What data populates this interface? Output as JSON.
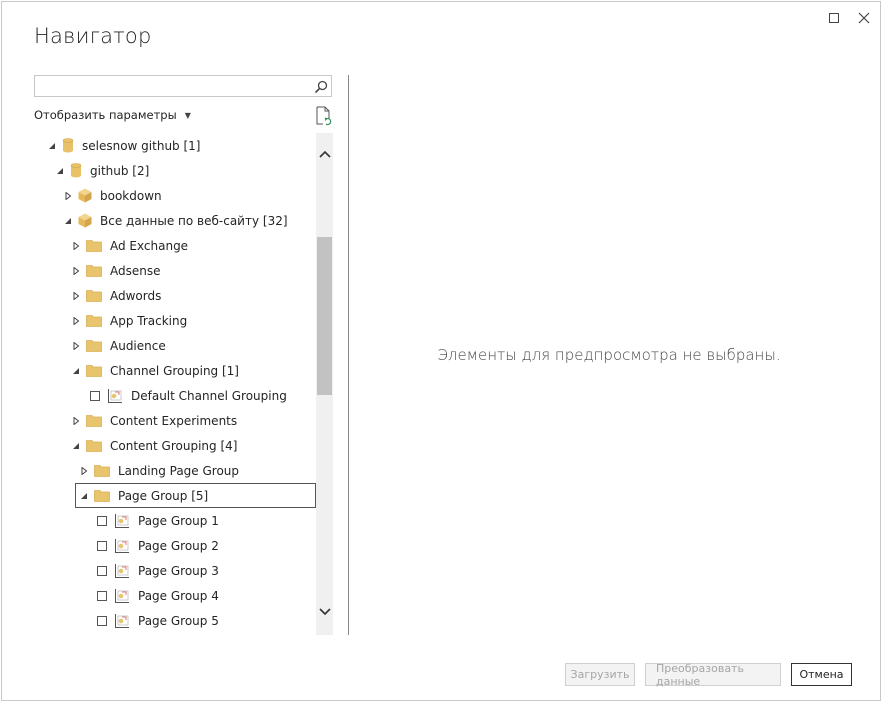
{
  "window": {
    "title": "Навигатор",
    "maximize_icon": "maximize-icon",
    "close_icon": "close-icon"
  },
  "left_pane": {
    "search": {
      "value": "",
      "placeholder": ""
    },
    "display_options_label": "Отобразить параметры",
    "tree": [
      {
        "label": "selesnow github [1]",
        "expanded": true,
        "icon": "database-icon",
        "checkbox": false
      },
      {
        "label": "github [2]",
        "expanded": true,
        "icon": "database-icon",
        "checkbox": false
      },
      {
        "label": "bookdown",
        "expanded": false,
        "icon": "cube-icon",
        "checkbox": false
      },
      {
        "label": "Все данные по веб-сайту [32]",
        "expanded": true,
        "icon": "cube-icon",
        "checkbox": false
      },
      {
        "label": "Ad Exchange",
        "expanded": false,
        "icon": "folder-icon",
        "checkbox": false
      },
      {
        "label": "Adsense",
        "expanded": false,
        "icon": "folder-icon",
        "checkbox": false
      },
      {
        "label": "Adwords",
        "expanded": false,
        "icon": "folder-icon",
        "checkbox": false
      },
      {
        "label": "App Tracking",
        "expanded": false,
        "icon": "folder-icon",
        "checkbox": false
      },
      {
        "label": "Audience",
        "expanded": false,
        "icon": "folder-icon",
        "checkbox": false
      },
      {
        "label": "Channel Grouping [1]",
        "expanded": true,
        "icon": "folder-icon",
        "checkbox": false
      },
      {
        "label": "Default Channel Grouping",
        "expanded": null,
        "icon": "chart-icon",
        "checkbox": true
      },
      {
        "label": "Content Experiments",
        "expanded": false,
        "icon": "folder-icon",
        "checkbox": false
      },
      {
        "label": "Content Grouping [4]",
        "expanded": true,
        "icon": "folder-icon",
        "checkbox": false
      },
      {
        "label": "Landing Page Group",
        "expanded": false,
        "icon": "folder-icon",
        "checkbox": false
      },
      {
        "label": "Page Group [5]",
        "expanded": true,
        "icon": "folder-icon",
        "checkbox": false,
        "focused": true
      },
      {
        "label": "Page Group 1",
        "expanded": null,
        "icon": "chart-icon",
        "checkbox": true
      },
      {
        "label": "Page Group 2",
        "expanded": null,
        "icon": "chart-icon",
        "checkbox": true
      },
      {
        "label": "Page Group 3",
        "expanded": null,
        "icon": "chart-icon",
        "checkbox": true
      },
      {
        "label": "Page Group 4",
        "expanded": null,
        "icon": "chart-icon",
        "checkbox": true
      },
      {
        "label": "Page Group 5",
        "expanded": null,
        "icon": "chart-icon",
        "checkbox": true
      }
    ]
  },
  "right_pane": {
    "empty_message": "Элементы для предпросмотра не выбраны."
  },
  "footer": {
    "load_label": "Загрузить",
    "transform_label": "Преобразовать данные",
    "cancel_label": "Отмена"
  },
  "colors": {
    "folder": "#e8c46c",
    "db": "#e9c168",
    "accent_border": "#333333"
  }
}
